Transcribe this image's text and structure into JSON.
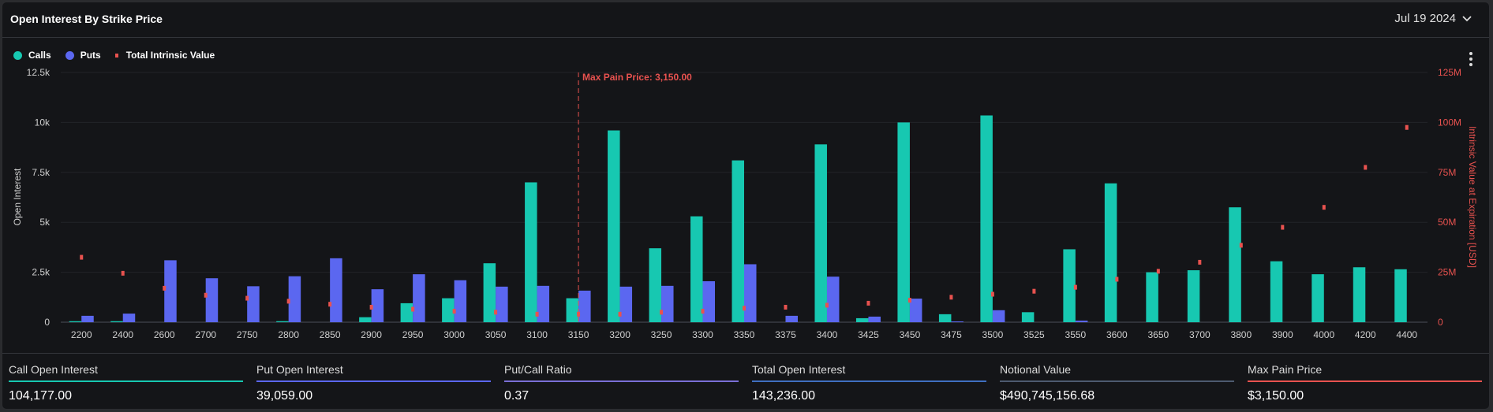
{
  "header": {
    "title": "Open Interest By Strike Price",
    "date": "Jul 19 2024"
  },
  "legend": {
    "calls": "Calls",
    "puts": "Puts",
    "intrinsic": "Total Intrinsic Value"
  },
  "colors": {
    "calls": "#17c8b1",
    "puts": "#5b67f0",
    "intrinsic": "#e8524f",
    "ratio": "#7a6fd6",
    "total": "#3f6fc0",
    "notional": "#4d5a70",
    "maxpain": "#e8524f"
  },
  "chart_data": {
    "type": "bar",
    "title": "Open Interest By Strike Price",
    "xlabel": "",
    "ylabel": "Open Interest",
    "y2label": "Intrinsic Value at Expiration [USD]",
    "ylim": [
      0,
      12500
    ],
    "y2lim": [
      0,
      125000000
    ],
    "yticks": [
      "0",
      "2.5k",
      "5k",
      "7.5k",
      "10k",
      "12.5k"
    ],
    "y2ticks": [
      "0",
      "25M",
      "50M",
      "75M",
      "100M",
      "125M"
    ],
    "grid": true,
    "legend_position": "top-left",
    "categories": [
      "2200",
      "2400",
      "2600",
      "2700",
      "2750",
      "2800",
      "2850",
      "2900",
      "2950",
      "3000",
      "3050",
      "3100",
      "3150",
      "3200",
      "3250",
      "3300",
      "3350",
      "3375",
      "3400",
      "3425",
      "3450",
      "3475",
      "3500",
      "3525",
      "3550",
      "3600",
      "3650",
      "3700",
      "3800",
      "3900",
      "4000",
      "4200",
      "4400"
    ],
    "series": [
      {
        "name": "Calls",
        "axis": "left",
        "values": [
          50,
          50,
          0,
          0,
          0,
          50,
          0,
          250,
          950,
          1200,
          2950,
          7000,
          1200,
          9600,
          3700,
          5300,
          8100,
          0,
          8900,
          200,
          10000,
          400,
          10350,
          500,
          3650,
          6950,
          2500,
          2600,
          5750,
          3050,
          2400,
          2750,
          2650
        ]
      },
      {
        "name": "Puts",
        "axis": "left",
        "values": [
          320,
          430,
          3100,
          2200,
          1800,
          2300,
          3200,
          1650,
          2400,
          2100,
          1780,
          1820,
          1580,
          1780,
          1820,
          2050,
          2900,
          320,
          2280,
          280,
          1180,
          40,
          600,
          0,
          80,
          0,
          0,
          0,
          0,
          0,
          0,
          0,
          0
        ]
      },
      {
        "name": "Total Intrinsic Value",
        "axis": "right",
        "type": "scatter",
        "values": [
          32500000,
          24500000,
          17000000,
          13500000,
          12000000,
          10500000,
          9000000,
          7500000,
          6500000,
          5500000,
          5000000,
          4000000,
          4000000,
          4000000,
          5000000,
          5500000,
          7000000,
          7500000,
          8500000,
          9500000,
          11000000,
          12500000,
          14000000,
          15500000,
          17500000,
          21500000,
          25500000,
          30000000,
          38500000,
          47500000,
          57500000,
          77500000,
          97500000
        ]
      }
    ],
    "annotations": [
      {
        "type": "vline",
        "category": "3150",
        "label": "Max Pain Price: 3,150.00"
      }
    ]
  },
  "stats": [
    {
      "label": "Call Open Interest",
      "value": "104,177.00",
      "color": "#17c8b1"
    },
    {
      "label": "Put Open Interest",
      "value": "39,059.00",
      "color": "#5b67f0"
    },
    {
      "label": "Put/Call Ratio",
      "value": "0.37",
      "color": "#7a6fd6"
    },
    {
      "label": "Total Open Interest",
      "value": "143,236.00",
      "color": "#3f6fc0"
    },
    {
      "label": "Notional Value",
      "value": "$490,745,156.68",
      "color": "#4d5a70"
    },
    {
      "label": "Max Pain Price",
      "value": "$3,150.00",
      "color": "#e8524f"
    }
  ]
}
